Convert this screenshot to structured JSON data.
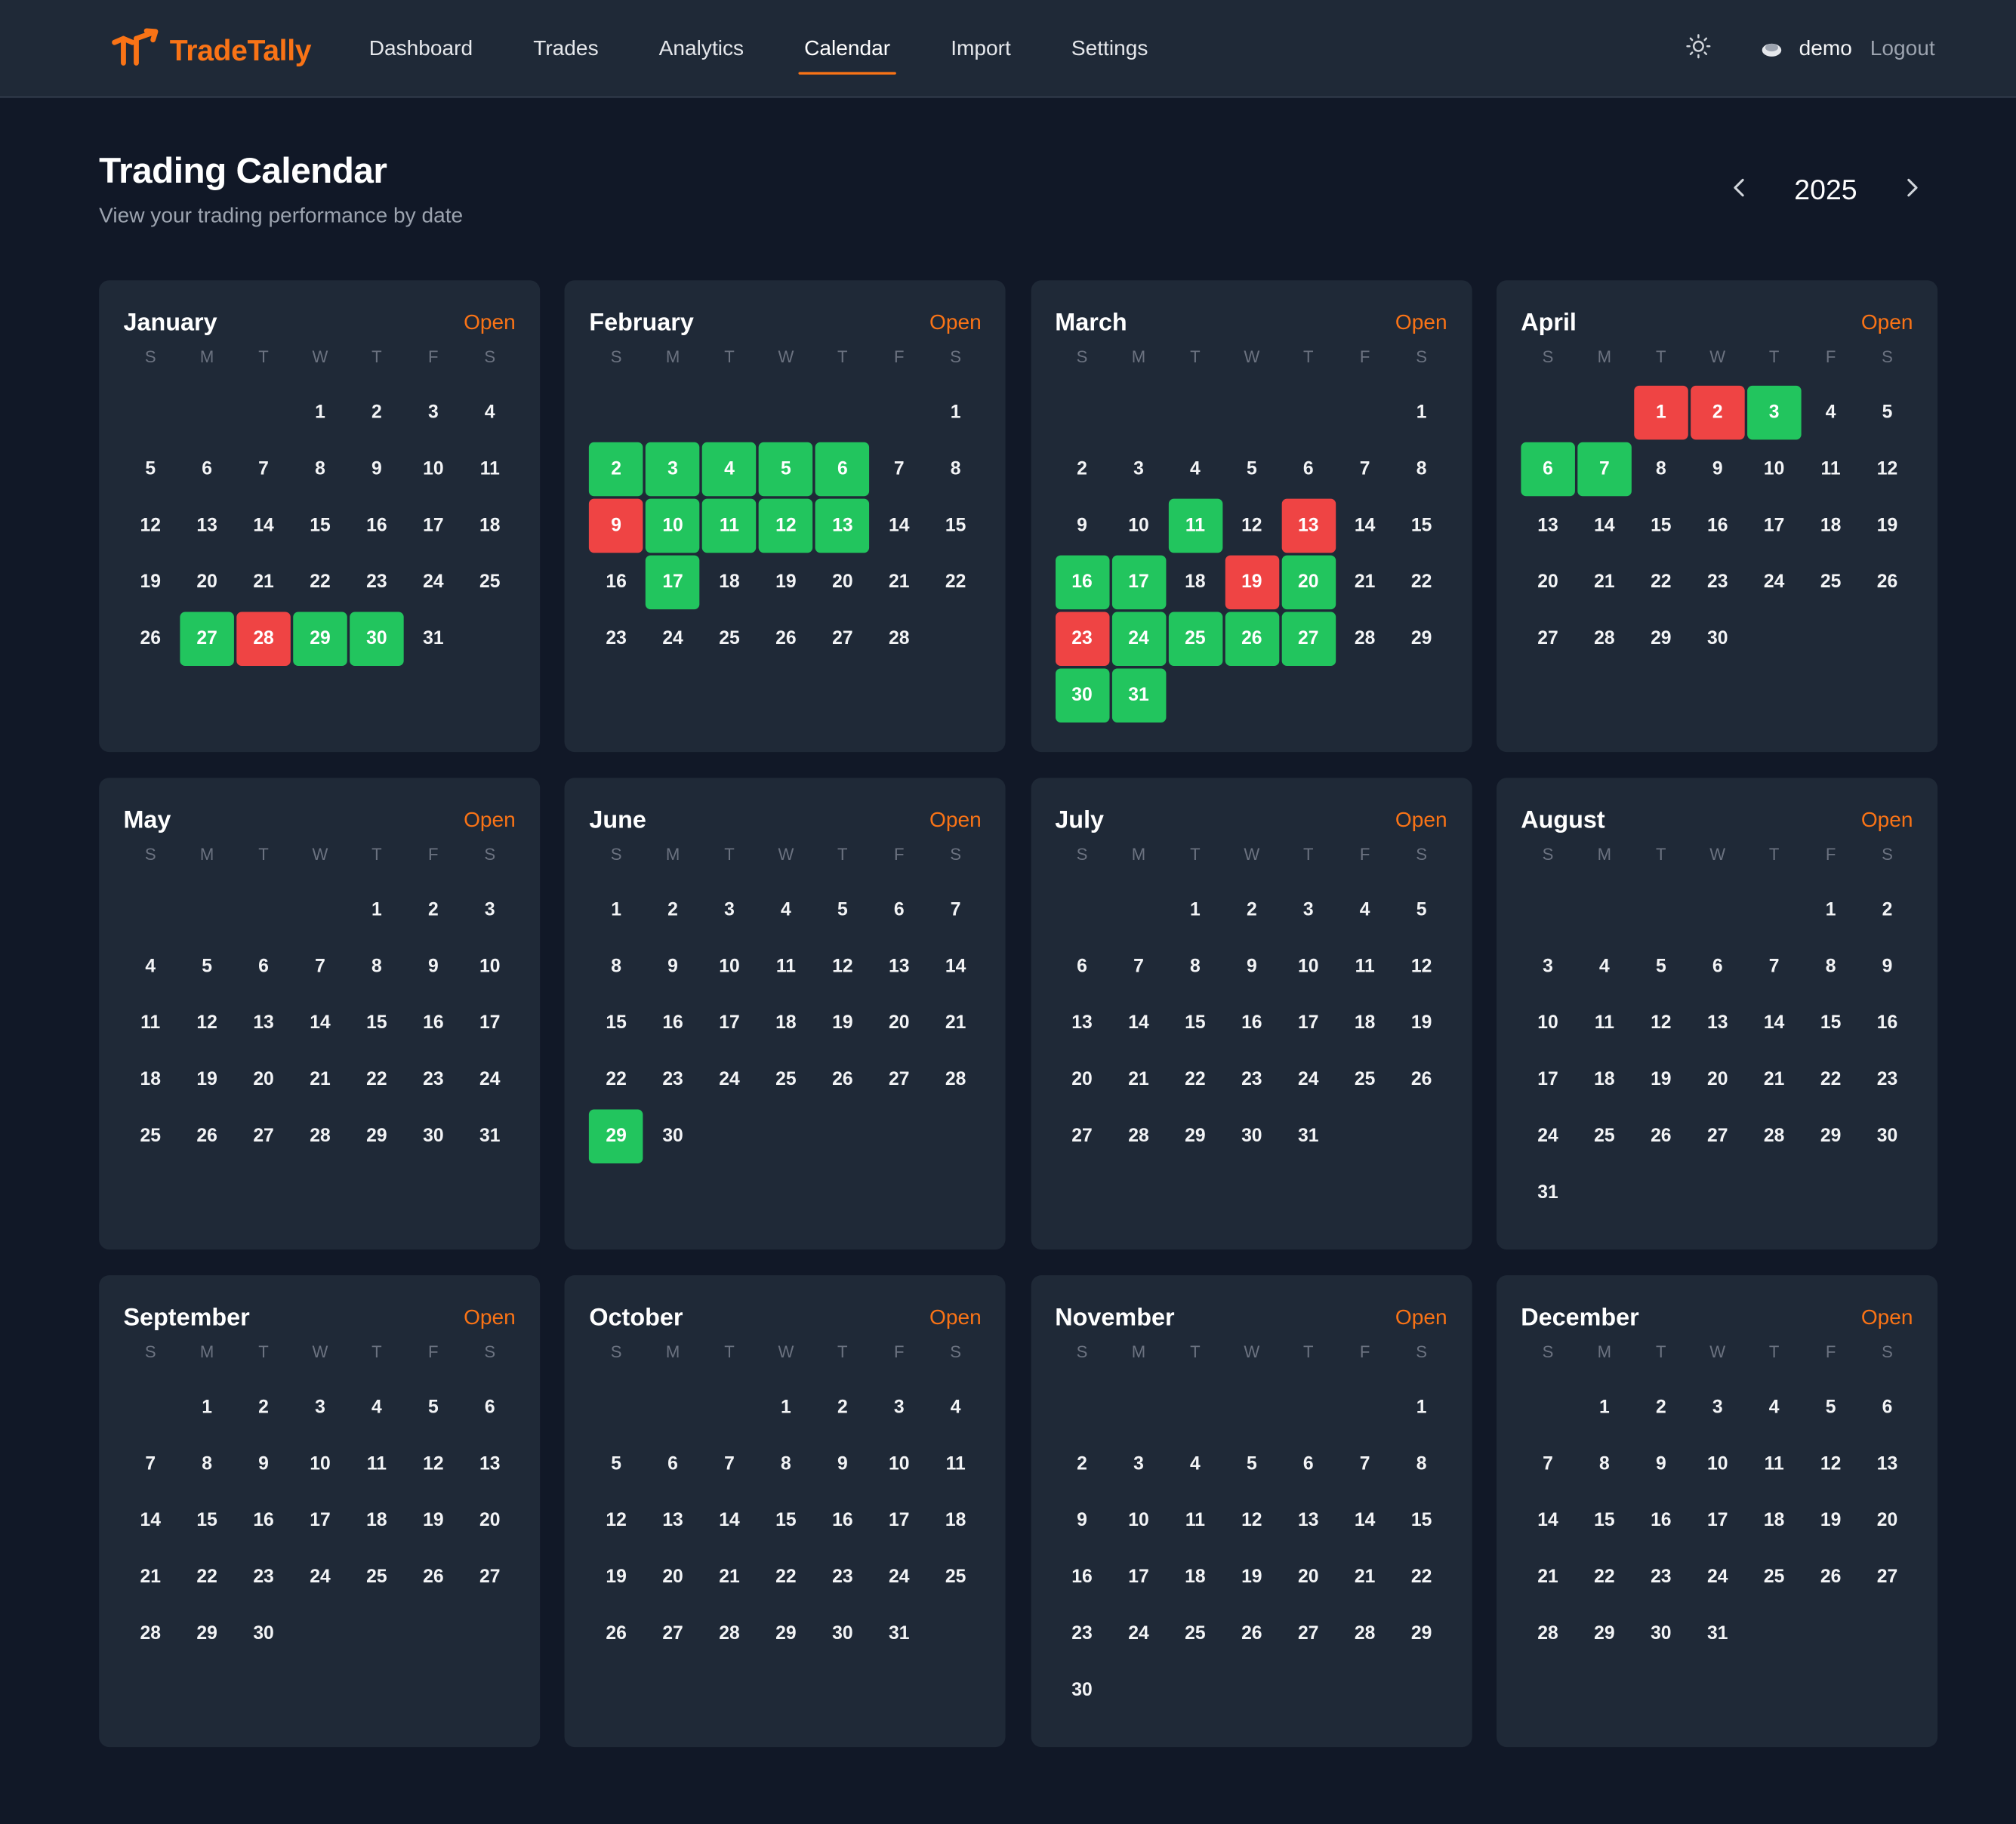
{
  "nav": {
    "brand": "TradeTally",
    "links": [
      "Dashboard",
      "Trades",
      "Analytics",
      "Calendar",
      "Import",
      "Settings"
    ],
    "active": "Calendar",
    "user": "demo",
    "logout": "Logout"
  },
  "page": {
    "title": "Trading Calendar",
    "subtitle": "View your trading performance by date",
    "year": "2025"
  },
  "colors": {
    "accent": "#f97316",
    "profit": "#22c55e",
    "loss": "#ef4444",
    "background": "#111827",
    "card": "#1f2937"
  },
  "weekdays": [
    "S",
    "M",
    "T",
    "W",
    "T",
    "F",
    "S"
  ],
  "open_label": "Open",
  "months": [
    {
      "name": "January",
      "offset": 3,
      "days": 31,
      "profit": [
        27,
        29,
        30
      ],
      "loss": [
        28
      ]
    },
    {
      "name": "February",
      "offset": 6,
      "days": 28,
      "profit": [
        2,
        3,
        4,
        5,
        6,
        10,
        11,
        12,
        13,
        17
      ],
      "loss": [
        9
      ]
    },
    {
      "name": "March",
      "offset": 6,
      "days": 31,
      "profit": [
        11,
        16,
        17,
        20,
        24,
        25,
        26,
        27,
        30,
        31
      ],
      "loss": [
        13,
        19,
        23
      ]
    },
    {
      "name": "April",
      "offset": 2,
      "days": 30,
      "profit": [
        3,
        6,
        7
      ],
      "loss": [
        1,
        2
      ]
    },
    {
      "name": "May",
      "offset": 4,
      "days": 31,
      "profit": [],
      "loss": []
    },
    {
      "name": "June",
      "offset": 0,
      "days": 30,
      "profit": [
        29
      ],
      "loss": []
    },
    {
      "name": "July",
      "offset": 2,
      "days": 31,
      "profit": [],
      "loss": []
    },
    {
      "name": "August",
      "offset": 5,
      "days": 31,
      "profit": [],
      "loss": []
    },
    {
      "name": "September",
      "offset": 1,
      "days": 30,
      "profit": [],
      "loss": []
    },
    {
      "name": "October",
      "offset": 3,
      "days": 31,
      "profit": [],
      "loss": []
    },
    {
      "name": "November",
      "offset": 6,
      "days": 30,
      "profit": [],
      "loss": []
    },
    {
      "name": "December",
      "offset": 1,
      "days": 31,
      "profit": [],
      "loss": []
    }
  ]
}
